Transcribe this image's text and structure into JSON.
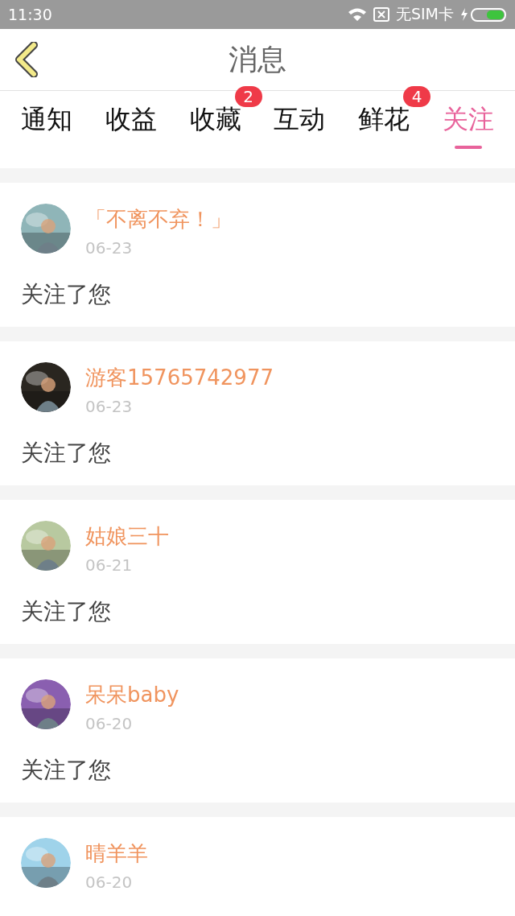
{
  "status_bar": {
    "time": "11:30",
    "carrier": "无SIM卡"
  },
  "header": {
    "title": "消息"
  },
  "tabs": [
    {
      "label": "通知",
      "selected": false
    },
    {
      "label": "收益",
      "selected": false
    },
    {
      "label": "收藏",
      "selected": false,
      "badge": "2"
    },
    {
      "label": "互动",
      "selected": false
    },
    {
      "label": "鲜花",
      "selected": false,
      "badge": "4"
    },
    {
      "label": "关注",
      "selected": true
    }
  ],
  "messages": [
    {
      "name": "「不离不弃！」",
      "date": "06-23",
      "text": "关注了您"
    },
    {
      "name": "游客15765742977",
      "date": "06-23",
      "text": "关注了您"
    },
    {
      "name": "姑娘三十",
      "date": "06-21",
      "text": "关注了您"
    },
    {
      "name": "呆呆baby",
      "date": "06-20",
      "text": "关注了您"
    },
    {
      "name": "晴羊羊",
      "date": "06-20"
    }
  ]
}
